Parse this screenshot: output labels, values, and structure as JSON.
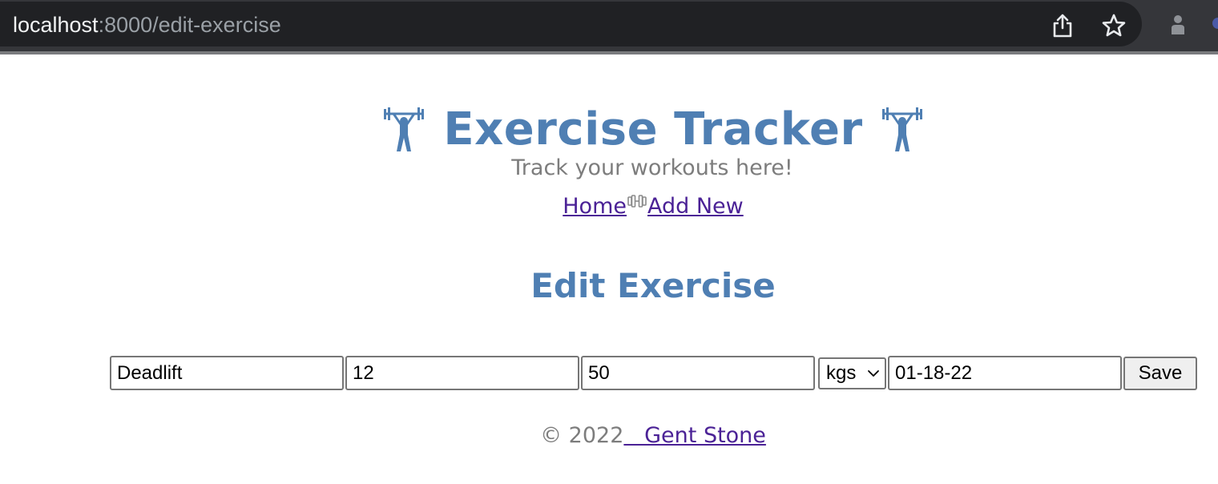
{
  "browser": {
    "url_host": "localhost",
    "url_path": ":8000/edit-exercise"
  },
  "header": {
    "title": "Exercise Tracker",
    "subtitle": "Track your workouts here!",
    "icon_left": "weightlifter-icon",
    "icon_right": "weightlifter-icon",
    "accent_color": "#4f7fb3"
  },
  "nav": {
    "home_label": "Home",
    "separator_icon": "dumbbell-icon",
    "add_new_label": "Add New",
    "link_color": "#4b2296"
  },
  "main": {
    "heading": "Edit Exercise"
  },
  "form": {
    "name_value": "Deadlift",
    "reps_value": "12",
    "weight_value": "50",
    "unit_selected": "kgs",
    "date_value": "01-18-22",
    "save_label": "Save"
  },
  "footer": {
    "copyright": "© 2022",
    "author_link": "   Gent Stone"
  }
}
